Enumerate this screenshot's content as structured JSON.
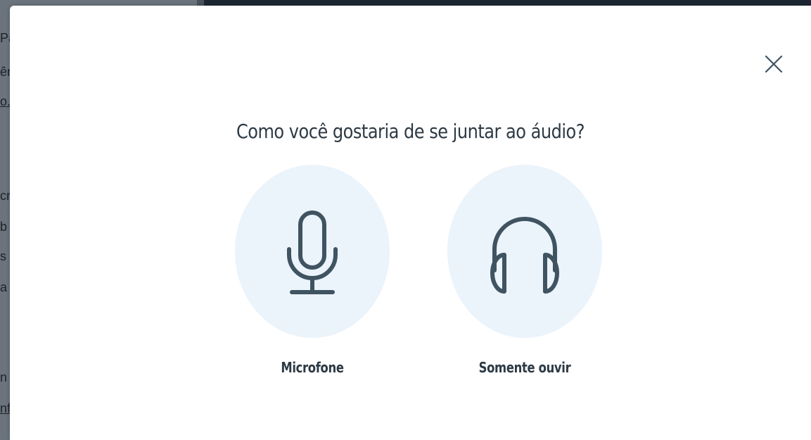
{
  "background": {
    "fragments": [
      "Pa",
      "ên",
      "o.l",
      "cr",
      "b",
      "s",
      "a",
      "n",
      "nf"
    ]
  },
  "modal": {
    "title": "Como você gostaria de se juntar ao áudio?",
    "close_icon": "close-x-icon",
    "options": [
      {
        "label": "Microfone",
        "icon": "microphone-icon"
      },
      {
        "label": "Somente ouvir",
        "icon": "headphones-icon"
      }
    ]
  },
  "colors": {
    "overlay": "#5d6670",
    "modal_bg": "#ffffff",
    "option_circle": "#ebf3fb",
    "icon_stroke": "#3f5361",
    "text": "#2d3a45"
  }
}
